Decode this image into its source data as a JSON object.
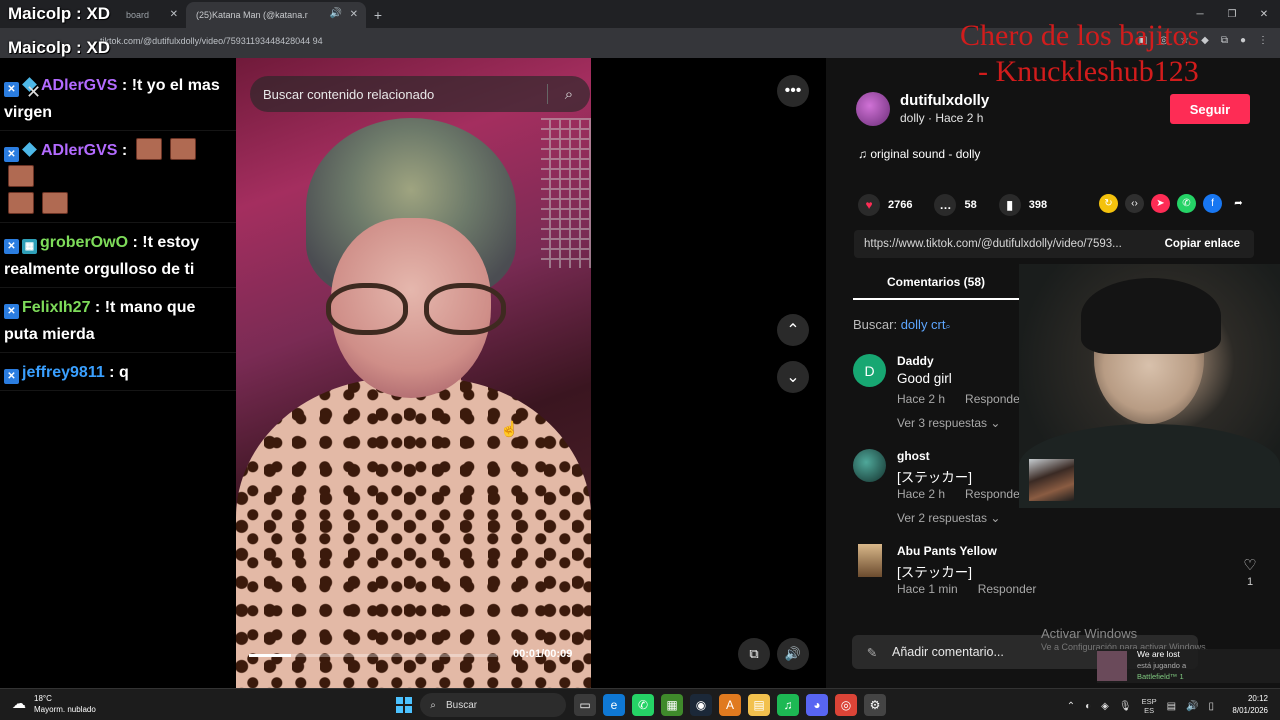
{
  "browser": {
    "tabs": [
      {
        "label": "board"
      },
      {
        "label": "(25)Katana Man (@katana.r"
      }
    ],
    "url": "tiktok.com/@dutifulxdolly/video/75931193448428044 94",
    "window_controls": [
      "─",
      "❐",
      "✕"
    ]
  },
  "overlay": {
    "streamer_name": "Maicolp : XD",
    "streamer_name_2": "Maicolp : XD",
    "credit_line1": "Chero de los bajitos",
    "credit_line2": "- Knuckleshub123"
  },
  "chat": {
    "messages": [
      {
        "user": "ADlerGVS",
        "user_color": "#b36bff",
        "text": " : !t yo el mas virgen"
      },
      {
        "user": "ADlerGVS",
        "user_color": "#b36bff",
        "text": " : "
      },
      {
        "user": "groberOwO",
        "user_color": "#7edc5a",
        "text": " : !t estoy realmente orgulloso de ti"
      },
      {
        "user": "FelixIh27",
        "user_color": "#7edc5a",
        "text": " : !t mano que puta mierda"
      },
      {
        "user": "jeffrey9811",
        "user_color": "#3aa0ff",
        "text": " : q"
      }
    ]
  },
  "video": {
    "search_placeholder": "Buscar contenido relacionado",
    "time": "00:01/00:09",
    "progress_fraction": 0.17
  },
  "sidebar": {
    "author": "dutifulxdolly",
    "meta": "dolly · Hace 2 h",
    "follow_label": "Seguir",
    "sound": "original sound - dolly",
    "likes": "2766",
    "comments": "58",
    "saves": "398",
    "link": "https://www.tiktok.com/@dutifulxdolly/video/7593...",
    "copy_label": "Copiar enlace",
    "comments_tab": "Comentarios (58)",
    "search_prefix": "Buscar:",
    "search_term": "dolly crt",
    "comment_list": [
      {
        "user": "Daddy",
        "text": "Good girl",
        "time": "Hace 2 h",
        "reply": "Responder",
        "more": "Ver 3 respuestas ⌄",
        "avatar_letter": "D"
      },
      {
        "user": "ghost",
        "text": "[ステッカー]",
        "time": "Hace 2 h",
        "reply": "Responder",
        "more": "Ver 2 respuestas ⌄"
      },
      {
        "user": "Abu Pants Yellow",
        "text": "[ステッカー]",
        "time": "Hace 1 min",
        "reply": "Responder",
        "like_count": "1"
      }
    ],
    "add_comment_placeholder": "Añadir comentario...",
    "activate_title": "Activar Windows",
    "activate_sub": "Ve a Configuración para activar Windows."
  },
  "notification": {
    "title": "We are lost",
    "subtitle": "está jugando a",
    "game": "Battlefield™ 1"
  },
  "taskbar": {
    "temp": "18°C",
    "condition": "Mayorm. nublado",
    "search_label": "Buscar",
    "lang_top": "ESP",
    "lang_bottom": "ES",
    "time": "20:12",
    "date": "8/01/2026"
  }
}
